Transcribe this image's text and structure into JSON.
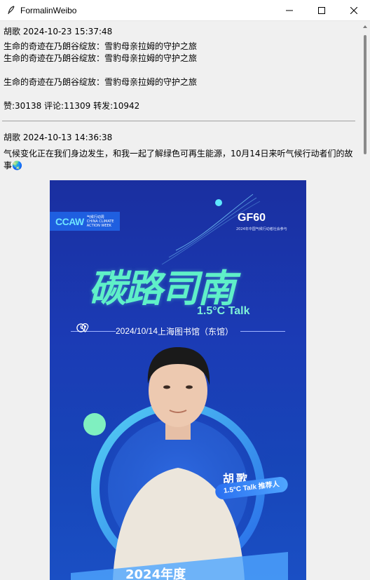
{
  "window": {
    "title": "FormalinWeibo",
    "icon": "feather-icon",
    "controls": [
      "minimize-icon",
      "maximize-icon",
      "close-icon"
    ]
  },
  "posts": [
    {
      "author": "胡歌",
      "time": "2024-10-23 15:37:48",
      "header": "胡歌 2024-10-23 15:37:48",
      "text": "生命的奇迹在乃朗谷绽放：雪豹母亲拉姆的守护之旅\n生命的奇迹在乃朗谷绽放：雪豹母亲拉姆的守护之旅\n\n生命的奇迹在乃朗谷绽放：雪豹母亲拉姆的守护之旅",
      "stats": "赞:30138 评论:11309 转发:10942"
    },
    {
      "author": "胡歌",
      "time": "2024-10-13 14:36:38",
      "header": "胡歌 2024-10-13 14:36:38",
      "text": "气候变化正在我们身边发生，和我一起了解绿色可再生能源，10月14日来听气候行动者们的故事",
      "emoji": "🌏",
      "image": {
        "logo_left": "CCAW",
        "logo_left_sub": "气候行动周 CHINA CLIMATE ACTION WEEK",
        "logo_right": "GF60",
        "logo_right_sub": "2024年中国气候行动者社会参与",
        "title": "碳路司南",
        "subtitle": "1.5°C Talk",
        "date": "2024/10/14",
        "venue": "上海图书馆（东馆）",
        "person_name": "胡歌",
        "person_role": "1.5°C Talk 推荐人",
        "bottom_text": "2024年度"
      }
    }
  ],
  "colors": {
    "window_bg": "#f0f0f0",
    "titlebar_bg": "#ffffff",
    "poster_bg": "#1b3bb5",
    "poster_accent": "#5ff0c8"
  }
}
